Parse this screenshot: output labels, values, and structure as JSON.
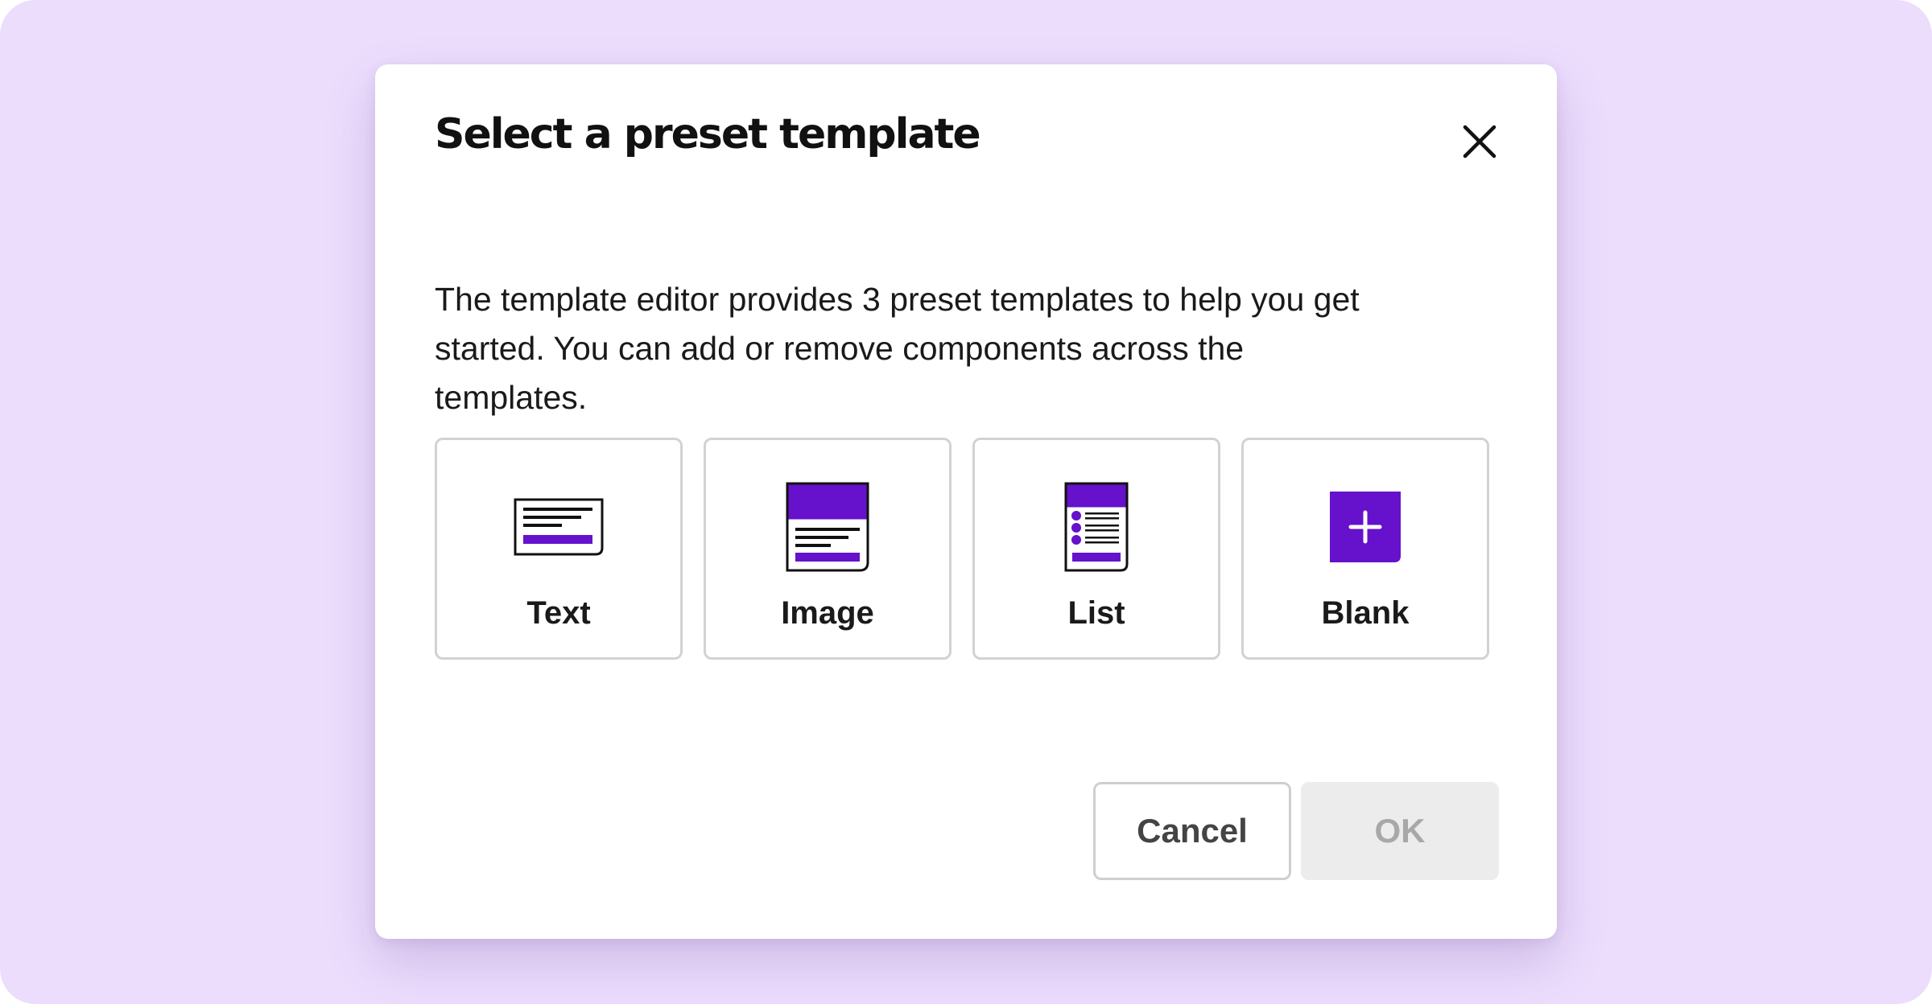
{
  "dialog": {
    "title": "Select a preset template",
    "description": "The template editor provides 3 preset templates to help you get started. You can add or remove components across the templates.",
    "close_icon": "close-icon"
  },
  "templates": [
    {
      "label": "Text",
      "icon": "text-template-icon"
    },
    {
      "label": "Image",
      "icon": "image-template-icon"
    },
    {
      "label": "List",
      "icon": "list-template-icon"
    },
    {
      "label": "Blank",
      "icon": "plus-icon"
    }
  ],
  "buttons": {
    "cancel_label": "Cancel",
    "ok_label": "OK",
    "ok_disabled": true
  },
  "colors": {
    "background": "#ecddfd",
    "accent": "#6611cc",
    "disabled_bg": "#ececec",
    "disabled_text": "#a8a8a8"
  }
}
